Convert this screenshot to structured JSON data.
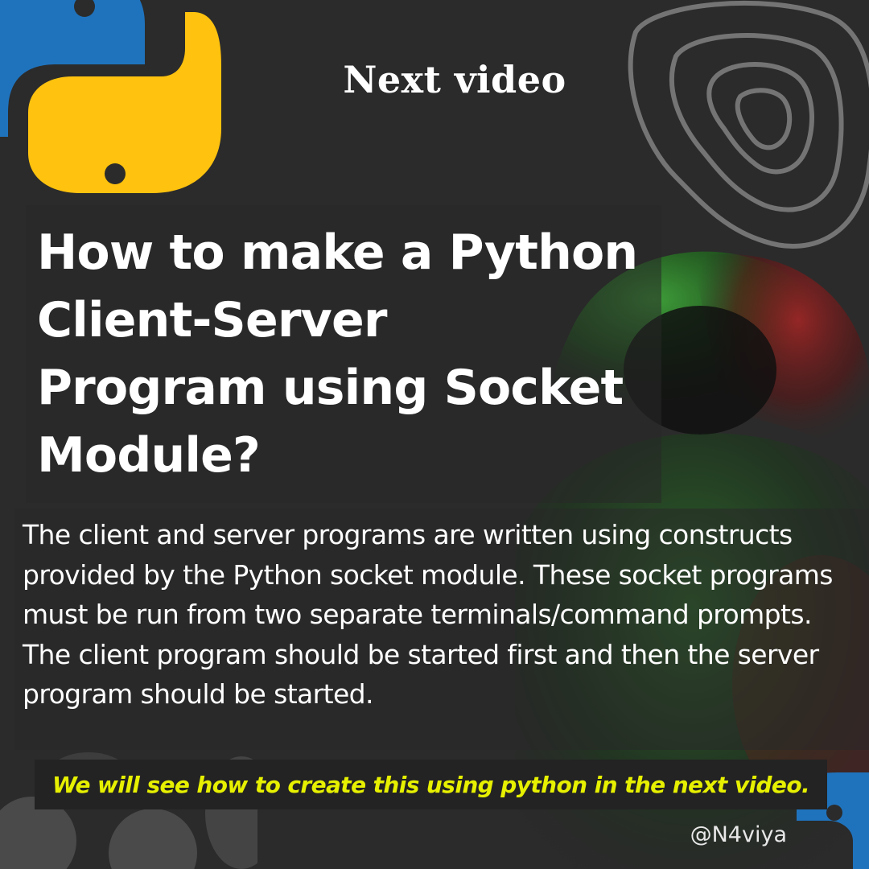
{
  "kicker": "Next video",
  "title_lines": [
    "How to make a Python",
    "Client-Server",
    "Program using Socket",
    "Module?"
  ],
  "body": "The client and server programs are written using constructs provided by the Python socket module. These socket programs must be run from two separate terminals/command prompts. The client program should be started first and then the server program should be started.",
  "banner": "We will see how to create this using python in the next video.",
  "handle": "@N4viya",
  "colors": {
    "background": "#2b2b2b",
    "python_blue": "#1f73bd",
    "python_yellow": "#ffc20e",
    "banner_text": "#e6f000",
    "banner_bg": "#232323",
    "glow_green": "#2f8a2a",
    "glow_red": "#7a1f1f"
  },
  "icons": [
    "python-logo-icon",
    "contour-lines-icon",
    "hooded-figure-image",
    "blob-decoration"
  ]
}
